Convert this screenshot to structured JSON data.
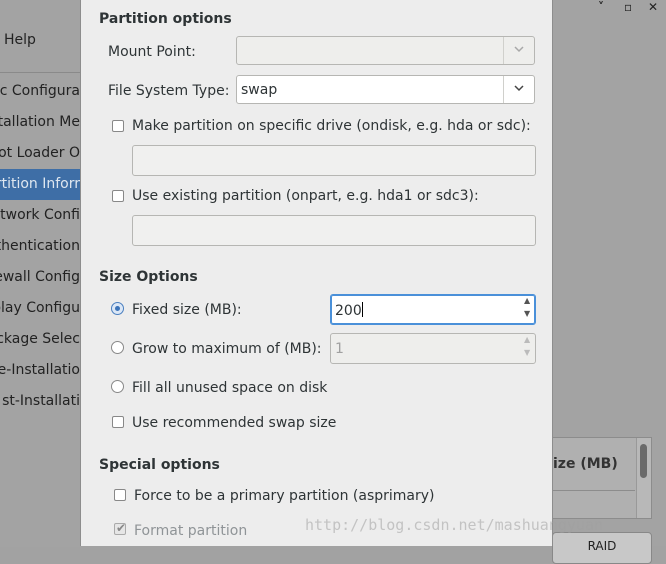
{
  "background": {
    "menu": {
      "help": "Help"
    },
    "window_controls": [
      "˅",
      "▫",
      "✕"
    ],
    "sidebar": {
      "items": [
        {
          "label": "sic Configura",
          "active": false
        },
        {
          "label": "stallation Me",
          "active": false
        },
        {
          "label": "ot Loader O",
          "active": false
        },
        {
          "label": "rtition Inforr",
          "active": true
        },
        {
          "label": "etwork Confi",
          "active": false
        },
        {
          "label": "thentication",
          "active": false
        },
        {
          "label": "ewall Config",
          "active": false
        },
        {
          "label": "splay Configu",
          "active": false
        },
        {
          "label": "ckage Selec",
          "active": false
        },
        {
          "label": "e-Installatio",
          "active": false
        },
        {
          "label": "st-Installati",
          "active": false
        }
      ]
    },
    "table": {
      "header": "ize (MB)"
    },
    "raid_button": "RAID"
  },
  "dialog": {
    "partition_options": {
      "title": "Partition options",
      "mount_point": {
        "label": "Mount Point:",
        "value": "",
        "enabled": false
      },
      "fs_type": {
        "label": "File System Type:",
        "value": "swap"
      },
      "ondisk": {
        "label": "Make partition on specific drive (ondisk, e.g. hda or sdc):",
        "checked": false,
        "value": ""
      },
      "onpart": {
        "label": "Use existing partition (onpart, e.g. hda1 or sdc3):",
        "checked": false,
        "value": ""
      }
    },
    "size_options": {
      "title": "Size Options",
      "fixed": {
        "label": "Fixed size (MB):",
        "selected": true,
        "value": "200"
      },
      "grow": {
        "label": "Grow to maximum of (MB):",
        "selected": false,
        "value": "1"
      },
      "fill": {
        "label": "Fill all unused space on disk",
        "selected": false
      },
      "recommended": {
        "label": "Use recommended swap size",
        "checked": false
      }
    },
    "special_options": {
      "title": "Special options",
      "primary": {
        "label": "Force to be a primary partition (asprimary)",
        "checked": false
      },
      "format": {
        "label": "Format partition",
        "checked": true,
        "enabled": false
      }
    }
  },
  "watermark": "http://blog.csdn.net/mashuangyuan"
}
